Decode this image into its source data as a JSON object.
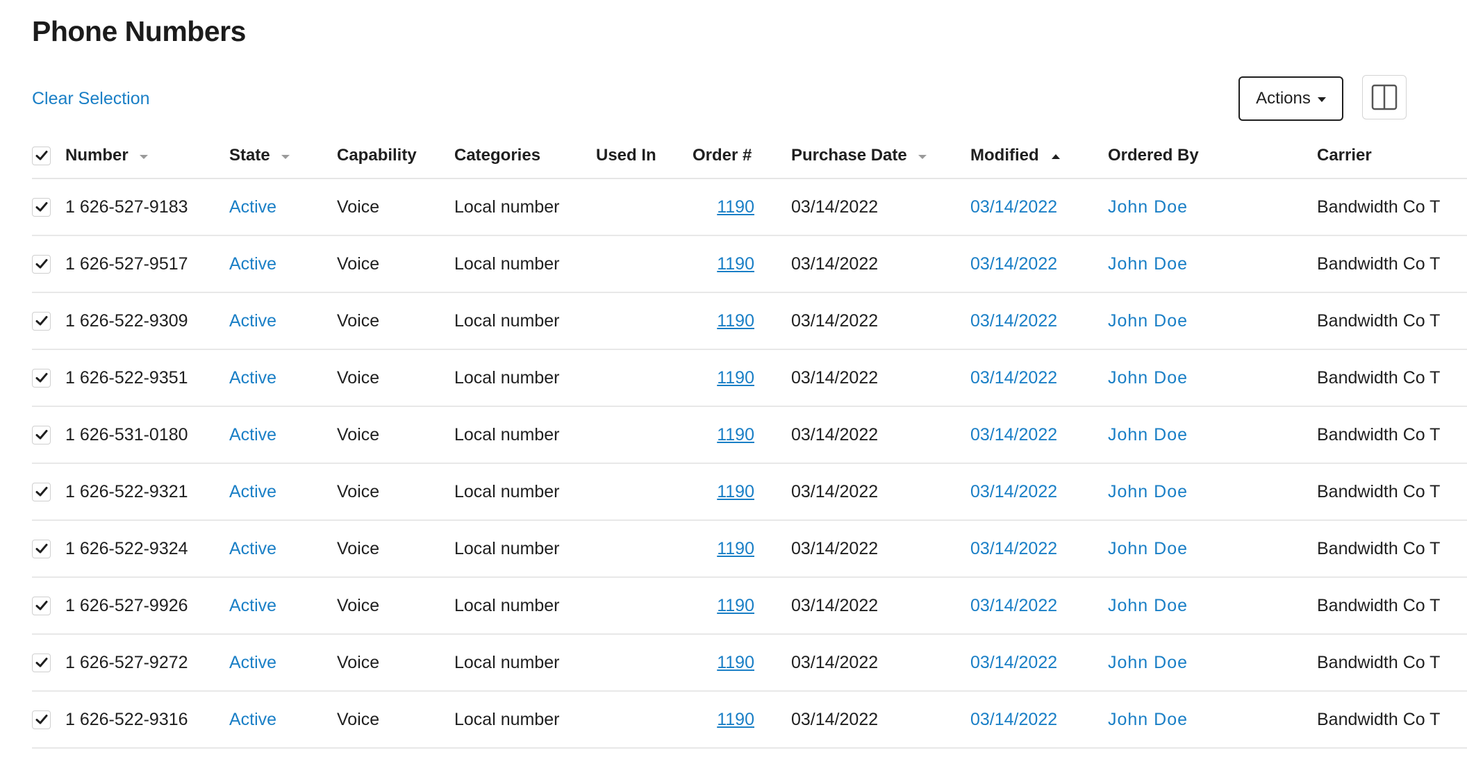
{
  "page": {
    "title": "Phone Numbers"
  },
  "toolbar": {
    "clear_selection_label": "Clear Selection",
    "actions_label": "Actions"
  },
  "colors": {
    "link": "#1a7fc6",
    "text": "#1f1f1f",
    "divider": "#e8e8e8"
  },
  "table": {
    "columns": {
      "number": "Number",
      "state": "State",
      "capability": "Capability",
      "categories": "Categories",
      "used_in": "Used In",
      "order": "Order #",
      "purchase_date": "Purchase Date",
      "modified": "Modified",
      "ordered_by": "Ordered By",
      "carrier": "Carrier"
    },
    "sort": {
      "modified": "ascending"
    },
    "select_all_checked": true,
    "rows": [
      {
        "checked": true,
        "number": "1 626-527-9183",
        "state": "Active",
        "capability": "Voice",
        "categories": "Local number",
        "used_in": "",
        "order": "1190",
        "purchase_date": "03/14/2022",
        "modified": "03/14/2022",
        "ordered_by": "John Doe",
        "carrier": "Bandwidth Co T"
      },
      {
        "checked": true,
        "number": "1 626-527-9517",
        "state": "Active",
        "capability": "Voice",
        "categories": "Local number",
        "used_in": "",
        "order": "1190",
        "purchase_date": "03/14/2022",
        "modified": "03/14/2022",
        "ordered_by": "John Doe",
        "carrier": "Bandwidth Co T"
      },
      {
        "checked": true,
        "number": "1 626-522-9309",
        "state": "Active",
        "capability": "Voice",
        "categories": "Local number",
        "used_in": "",
        "order": "1190",
        "purchase_date": "03/14/2022",
        "modified": "03/14/2022",
        "ordered_by": "John Doe",
        "carrier": "Bandwidth Co T"
      },
      {
        "checked": true,
        "number": "1 626-522-9351",
        "state": "Active",
        "capability": "Voice",
        "categories": "Local number",
        "used_in": "",
        "order": "1190",
        "purchase_date": "03/14/2022",
        "modified": "03/14/2022",
        "ordered_by": "John Doe",
        "carrier": "Bandwidth Co T"
      },
      {
        "checked": true,
        "number": "1 626-531-0180",
        "state": "Active",
        "capability": "Voice",
        "categories": "Local number",
        "used_in": "",
        "order": "1190",
        "purchase_date": "03/14/2022",
        "modified": "03/14/2022",
        "ordered_by": "John Doe",
        "carrier": "Bandwidth Co T"
      },
      {
        "checked": true,
        "number": "1 626-522-9321",
        "state": "Active",
        "capability": "Voice",
        "categories": "Local number",
        "used_in": "",
        "order": "1190",
        "purchase_date": "03/14/2022",
        "modified": "03/14/2022",
        "ordered_by": "John Doe",
        "carrier": "Bandwidth Co T"
      },
      {
        "checked": true,
        "number": "1 626-522-9324",
        "state": "Active",
        "capability": "Voice",
        "categories": "Local number",
        "used_in": "",
        "order": "1190",
        "purchase_date": "03/14/2022",
        "modified": "03/14/2022",
        "ordered_by": "John Doe",
        "carrier": "Bandwidth Co T"
      },
      {
        "checked": true,
        "number": "1 626-527-9926",
        "state": "Active",
        "capability": "Voice",
        "categories": "Local number",
        "used_in": "",
        "order": "1190",
        "purchase_date": "03/14/2022",
        "modified": "03/14/2022",
        "ordered_by": "John Doe",
        "carrier": "Bandwidth Co T"
      },
      {
        "checked": true,
        "number": "1 626-527-9272",
        "state": "Active",
        "capability": "Voice",
        "categories": "Local number",
        "used_in": "",
        "order": "1190",
        "purchase_date": "03/14/2022",
        "modified": "03/14/2022",
        "ordered_by": "John Doe",
        "carrier": "Bandwidth Co T"
      },
      {
        "checked": true,
        "number": "1 626-522-9316",
        "state": "Active",
        "capability": "Voice",
        "categories": "Local number",
        "used_in": "",
        "order": "1190",
        "purchase_date": "03/14/2022",
        "modified": "03/14/2022",
        "ordered_by": "John Doe",
        "carrier": "Bandwidth Co T"
      }
    ]
  }
}
